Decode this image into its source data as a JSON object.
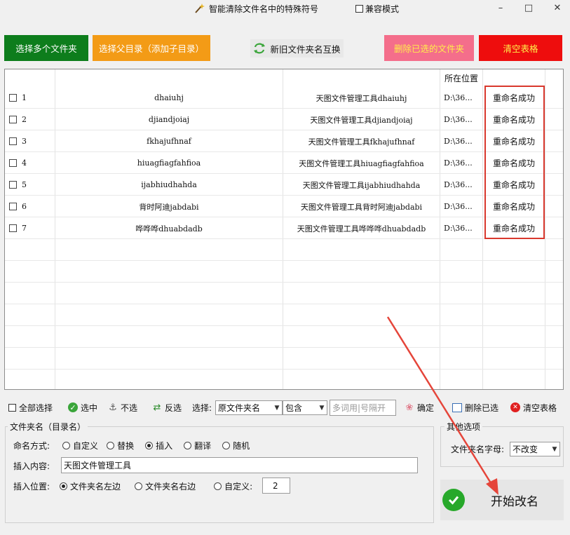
{
  "window": {
    "title": "智能清除文件名中的特殊符号",
    "compat_mode": "兼容模式",
    "minimize": "–",
    "maximize": "□",
    "close": "✕"
  },
  "toolbar": {
    "select_folders": "选择多个文件夹",
    "select_parent": "选择父目录（添加子目录）",
    "swap_names": "新旧文件夹名互换",
    "delete_selected": "删除已选的文件夹",
    "clear_table": "清空表格"
  },
  "table": {
    "columns": [
      "",
      "",
      "",
      "所在位置",
      ""
    ],
    "rows": [
      {
        "index": "1",
        "original": "dhaiuhj",
        "new": "天图文件管理工具dhaiuhj",
        "location": "D:\\36...",
        "status": "重命名成功"
      },
      {
        "index": "2",
        "original": "djiandjoiaj",
        "new": "天图文件管理工具djiandjoiaj",
        "location": "D:\\36...",
        "status": "重命名成功"
      },
      {
        "index": "3",
        "original": "fkhajufhnaf",
        "new": "天图文件管理工具fkhajufhnaf",
        "location": "D:\\36...",
        "status": "重命名成功"
      },
      {
        "index": "4",
        "original": "hiuagfiagfahfioa",
        "new": "天图文件管理工具hiuagfiagfahfioa",
        "location": "D:\\36...",
        "status": "重命名成功"
      },
      {
        "index": "5",
        "original": "ijabhiudhahda",
        "new": "天图文件管理工具ijabhiudhahda",
        "location": "D:\\36...",
        "status": "重命名成功"
      },
      {
        "index": "6",
        "original": "背时阿迪jabdabi",
        "new": "天图文件管理工具背时阿迪jabdabi",
        "location": "D:\\36...",
        "status": "重命名成功"
      },
      {
        "index": "7",
        "original": "哗哗哗dhuabdadb",
        "new": "天图文件管理工具哗哗哗dhuabdadb",
        "location": "D:\\36...",
        "status": "重命名成功"
      }
    ]
  },
  "selection_bar": {
    "select_all": "全部选择",
    "select": "选中",
    "unselect": "不选",
    "invert": "反选",
    "choose_label": "选择:",
    "field_value": "原文件夹名",
    "match_value": "包含",
    "keyword_placeholder": "多词用|号隔开",
    "confirm": "确定",
    "delete_selected": "删除已选",
    "clear_table": "清空表格"
  },
  "folder_name_group": {
    "title": "文件夹名（目录名）",
    "naming_label": "命名方式:",
    "naming_options": [
      "自定义",
      "替换",
      "插入",
      "翻译",
      "随机"
    ],
    "naming_selected": "插入",
    "insert_content_label": "插入内容:",
    "insert_content_value": "天图文件管理工具",
    "insert_position_label": "插入位置:",
    "position_left": "文件夹名左边",
    "position_right": "文件夹名右边",
    "position_custom": "自定义:",
    "position_custom_value": "2"
  },
  "other_options": {
    "title": "其他选项",
    "letters_label": "文件夹名字母:",
    "letters_value": "不改变"
  },
  "start": {
    "label": "开始改名"
  },
  "colors": {
    "green": "#0d7d1c",
    "orange": "#f39b16",
    "pink": "#f46e8b",
    "red": "#ee0d0d",
    "annotation": "#d9382d"
  }
}
